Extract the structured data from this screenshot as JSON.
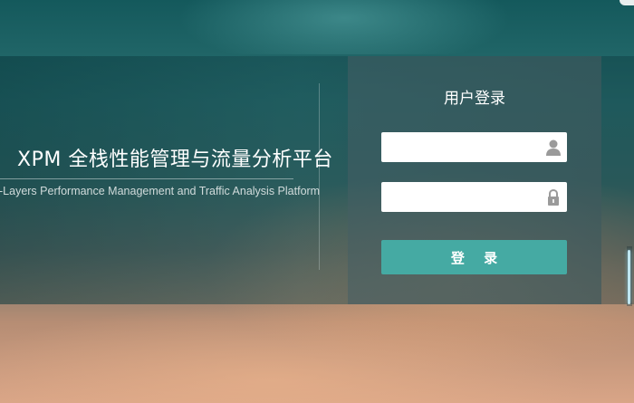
{
  "brand": {
    "title": "XPM 全栈性能管理与流量分析平台",
    "subtitle": "-Layers Performance Management and Traffic Analysis Platform"
  },
  "login": {
    "title": "用户登录",
    "username_value": "",
    "password_value": "",
    "button_label": "登 录",
    "username_icon": "user-icon",
    "password_icon": "lock-icon"
  },
  "colors": {
    "accent": "#45aaa3",
    "icon": "#9a9a9a"
  }
}
